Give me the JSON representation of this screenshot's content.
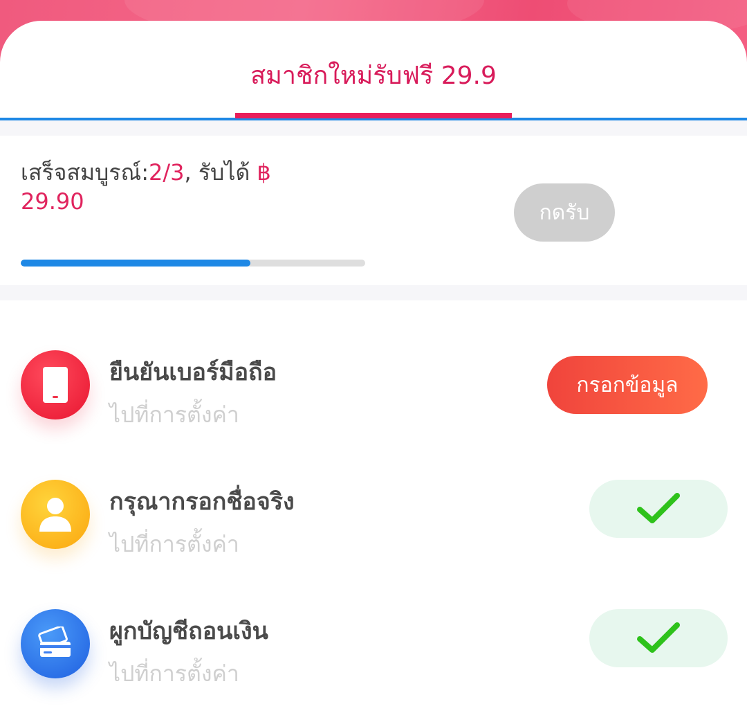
{
  "tab": {
    "label": "สมาชิกใหม่รับฟรี 29.9"
  },
  "progress": {
    "prefix": "เสร็จสมบูรณ์:",
    "count": "2/3",
    "middle": ", รับได้ ",
    "currency": "฿",
    "amount": "29.90",
    "fraction": 0.6667,
    "claim_label": "กดรับ"
  },
  "tasks": [
    {
      "title": "ยืนยันเบอร์มือถือ",
      "subtitle": "ไปที่การตั้งค่า",
      "icon": "phone-icon",
      "action": "กรอกข้อมูล",
      "done": false
    },
    {
      "title": "กรุณากรอกชื่อจริง",
      "subtitle": "ไปที่การตั้งค่า",
      "icon": "user-icon",
      "done": true
    },
    {
      "title": "ผูกบัญชีถอนเงิน",
      "subtitle": "ไปที่การตั้งค่า",
      "icon": "bank-card-icon",
      "done": true
    }
  ],
  "colors": {
    "accent_pink": "#e0245e",
    "tab_blue": "#1e88e5",
    "check_green": "#2ec21b",
    "action_red": "#f0443c"
  }
}
